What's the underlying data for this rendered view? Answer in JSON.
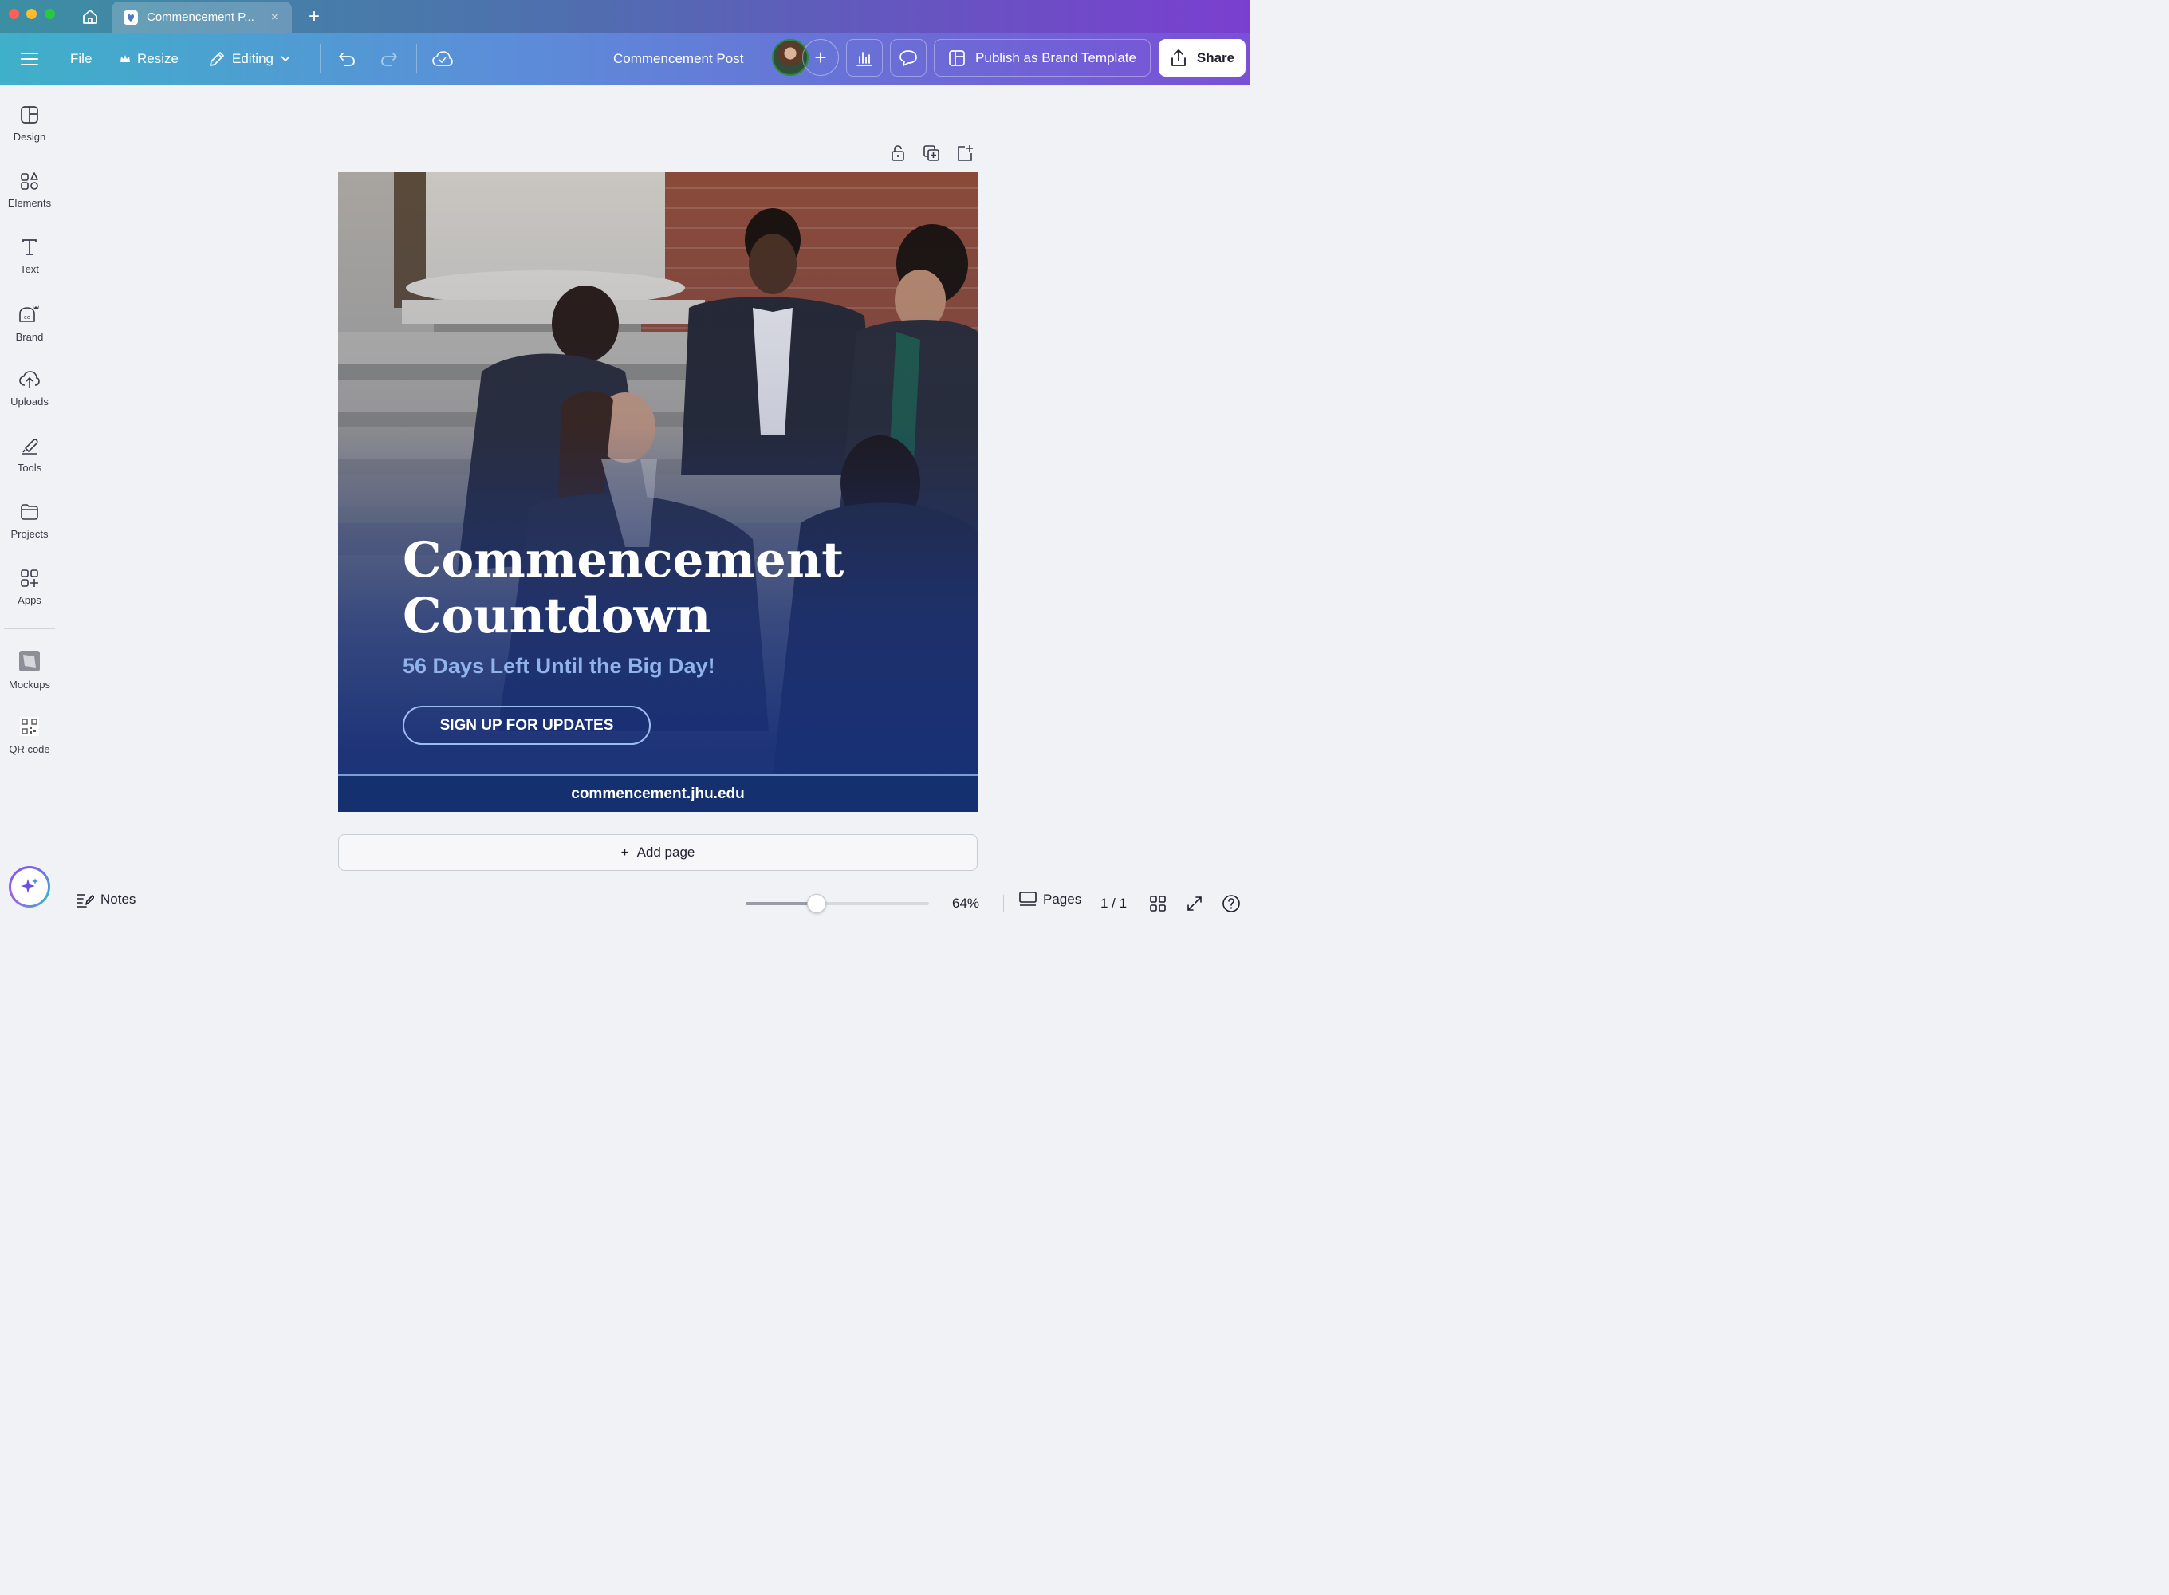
{
  "browser": {
    "tab_title": "Commencement P...",
    "close_glyph": "×",
    "new_tab_glyph": "+"
  },
  "toolbar": {
    "menu_icon": "hamburger-icon",
    "file_label": "File",
    "resize_label": "Resize",
    "editing_label": "Editing",
    "document_title": "Commencement Post",
    "add_collaborator_glyph": "+",
    "publish_label": "Publish as Brand Template",
    "share_label": "Share"
  },
  "sidebar": {
    "items": [
      {
        "label": "Design",
        "icon": "design-icon"
      },
      {
        "label": "Elements",
        "icon": "elements-icon"
      },
      {
        "label": "Text",
        "icon": "text-icon"
      },
      {
        "label": "Brand",
        "icon": "brand-icon"
      },
      {
        "label": "Uploads",
        "icon": "uploads-icon"
      },
      {
        "label": "Tools",
        "icon": "tools-icon"
      },
      {
        "label": "Projects",
        "icon": "projects-icon"
      },
      {
        "label": "Apps",
        "icon": "apps-icon"
      },
      {
        "label": "Mockups",
        "icon": "mockups-icon"
      },
      {
        "label": "QR code",
        "icon": "qr-code-icon"
      }
    ]
  },
  "design": {
    "headline_line1": "Commencement",
    "headline_line2": "Countdown",
    "subhead": "56 Days Left Until the Big Day!",
    "cta_label": "SIGN UP FOR UPDATES",
    "footer_url": "commencement.jhu.edu",
    "colors": {
      "navy": "#14306f",
      "accent_blue": "#8fb3ea",
      "white": "#ffffff"
    }
  },
  "canvas": {
    "add_page_label": "Add page",
    "add_page_glyph": "+"
  },
  "bottom_bar": {
    "notes_label": "Notes",
    "zoom_value": 0.64,
    "zoom_label": "64%",
    "pages_label": "Pages",
    "page_count": "1 / 1"
  },
  "brand_colors": {
    "toolbar_start": "#3fb0c9",
    "toolbar_end": "#7a50d6"
  }
}
